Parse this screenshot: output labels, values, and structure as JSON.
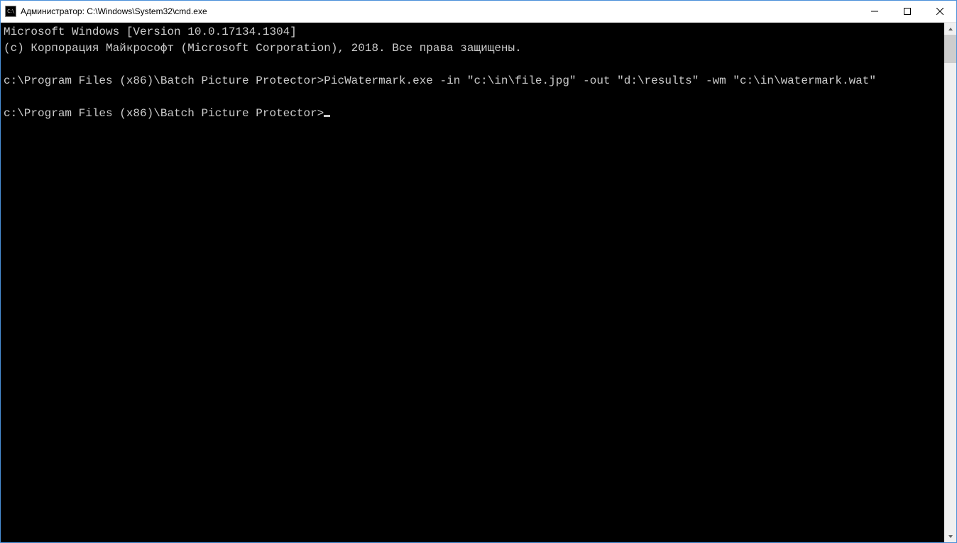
{
  "window": {
    "title": "Администратор: C:\\Windows\\System32\\cmd.exe"
  },
  "terminal": {
    "line1": "Microsoft Windows [Version 10.0.17134.1304]",
    "line2": "(c) Корпорация Майкрософт (Microsoft Corporation), 2018. Все права защищены.",
    "blank1": "",
    "cmd_line": "c:\\Program Files (x86)\\Batch Picture Protector>PicWatermark.exe -in \"c:\\in\\file.jpg\" -out \"d:\\results\" -wm \"c:\\in\\watermark.wat\"",
    "blank2": "",
    "prompt": "c:\\Program Files (x86)\\Batch Picture Protector>"
  }
}
